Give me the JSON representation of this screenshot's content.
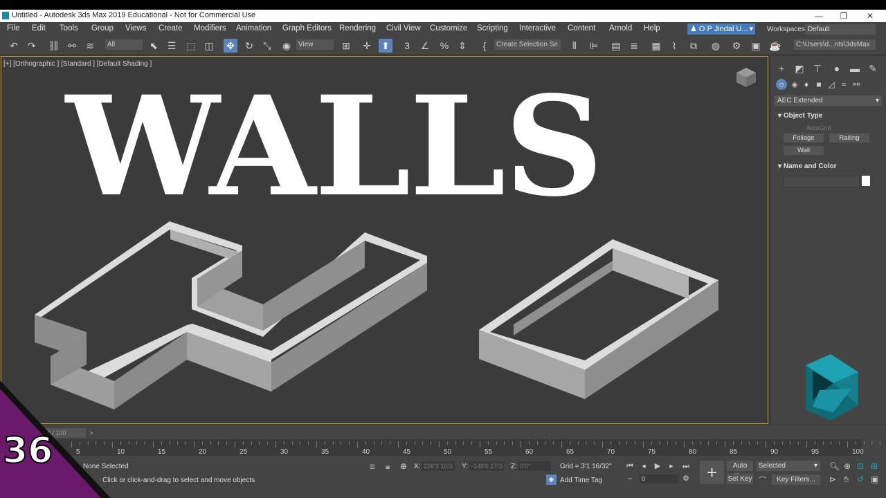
{
  "window": {
    "title": "Untitled - Autodesk 3ds Max 2019 Educational - Not for Commercial Use",
    "controls": [
      "—",
      "❐",
      "✕"
    ]
  },
  "menu": {
    "items": [
      "File",
      "Edit",
      "Tools",
      "Group",
      "Views",
      "Create",
      "Modifiers",
      "Animation",
      "Graph Editors",
      "Rendering",
      "Civil View",
      "Customize",
      "Scripting",
      "Interactive",
      "Content",
      "Arnold",
      "Help"
    ],
    "user": "O P Jindal U...",
    "workspaces_label": "Workspaces:",
    "workspaces_value": "Default"
  },
  "toolbar": {
    "filter_value": "All",
    "refcoord_value": "View",
    "selection_set_value": "Create Selection Se",
    "project_path": "C:\\Users\\d...nts\\3dsMax"
  },
  "viewport": {
    "label": "[+] [Orthographic ] [Standard ] [Default Shading ]",
    "overlay_title": "WALLS"
  },
  "command_panel": {
    "category_value": "AEC Extended",
    "object_type_title": "Object Type",
    "autogrid_label": "AutoGrid",
    "buttons": [
      "Foliage",
      "Railing",
      "Wall"
    ],
    "name_color_title": "Name and Color"
  },
  "timeline": {
    "frame_display": "0 / 100",
    "ticks": [
      "5",
      "10",
      "15",
      "20",
      "25",
      "30",
      "35",
      "40",
      "45",
      "50",
      "55",
      "60",
      "65",
      "70",
      "75",
      "80",
      "85",
      "90",
      "95",
      "100"
    ]
  },
  "status": {
    "selection": "None Selected",
    "hint": "Click or click-and-drag to select and move objects",
    "x_label": "X:",
    "x_value": "226'3 10/3",
    "y_label": "Y:",
    "y_value": "-148'6 17/3",
    "z_label": "Z:",
    "z_value": "0'0\"",
    "grid": "Grid = 3'1 16/32\"",
    "add_time_tag": "Add Time Tag",
    "current_frame": "0",
    "auto_key": "Auto Key",
    "set_key": "Set Key",
    "selected_value": "Selected",
    "key_filters": "Key Filters..."
  },
  "episode_badge": {
    "number": "36",
    "color": "#6b1a6b"
  },
  "colors": {
    "accent_blue": "#5d84b8",
    "viewport_border": "#c89a36",
    "logo_teal": "#1ea3b3"
  }
}
